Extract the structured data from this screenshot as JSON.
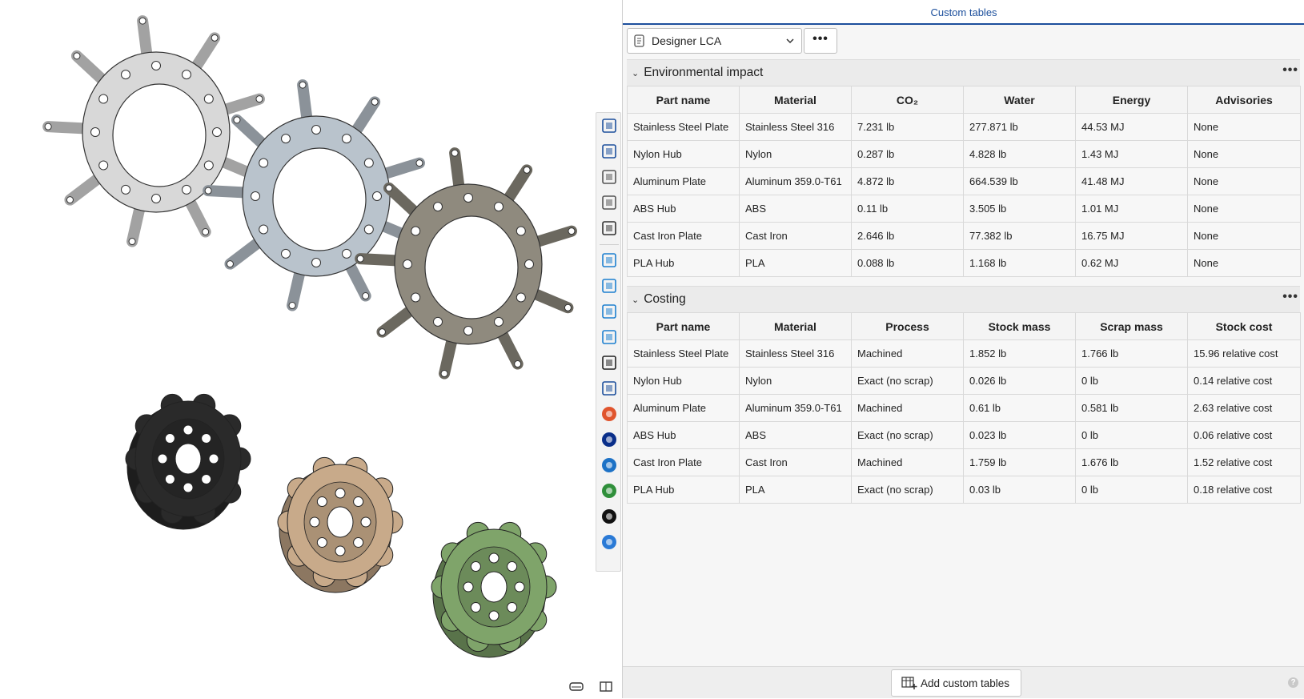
{
  "panel": {
    "title": "Custom tables",
    "selector_value": "Designer LCA",
    "more_label": "•••",
    "add_button_label": "Add custom tables",
    "help_label": "?"
  },
  "environmental": {
    "title": "Environmental impact",
    "columns": [
      "Part name",
      "Material",
      "CO₂",
      "Water",
      "Energy",
      "Advisories"
    ],
    "rows": [
      [
        "Stainless Steel Plate",
        "Stainless Steel 316",
        "7.231 lb",
        "277.871 lb",
        "44.53 MJ",
        "None"
      ],
      [
        "Nylon Hub",
        "Nylon",
        "0.287 lb",
        "4.828 lb",
        "1.43 MJ",
        "None"
      ],
      [
        "Aluminum Plate",
        "Aluminum 359.0-T61",
        "4.872 lb",
        "664.539 lb",
        "41.48 MJ",
        "None"
      ],
      [
        "ABS Hub",
        "ABS",
        "0.11 lb",
        "3.505 lb",
        "1.01 MJ",
        "None"
      ],
      [
        "Cast Iron Plate",
        "Cast Iron",
        "2.646 lb",
        "77.382 lb",
        "16.75 MJ",
        "None"
      ],
      [
        "PLA Hub",
        "PLA",
        "0.088 lb",
        "1.168 lb",
        "0.62 MJ",
        "None"
      ]
    ]
  },
  "costing": {
    "title": "Costing",
    "columns": [
      "Part name",
      "Material",
      "Process",
      "Stock mass",
      "Scrap mass",
      "Stock cost"
    ],
    "rows": [
      [
        "Stainless Steel Plate",
        "Stainless Steel 316",
        "Machined",
        "1.852 lb",
        "1.766 lb",
        "15.96 relative cost"
      ],
      [
        "Nylon Hub",
        "Nylon",
        "Exact (no scrap)",
        "0.026 lb",
        "0 lb",
        "0.14 relative cost"
      ],
      [
        "Aluminum Plate",
        "Aluminum 359.0-T61",
        "Machined",
        "0.61 lb",
        "0.581 lb",
        "2.63 relative cost"
      ],
      [
        "ABS Hub",
        "ABS",
        "Exact (no scrap)",
        "0.023 lb",
        "0 lb",
        "0.06 relative cost"
      ],
      [
        "Cast Iron Plate",
        "Cast Iron",
        "Machined",
        "1.759 lb",
        "1.676 lb",
        "1.52 relative cost"
      ],
      [
        "PLA Hub",
        "PLA",
        "Exact (no scrap)",
        "0.03 lb",
        "0 lb",
        "0.18 relative cost"
      ]
    ]
  },
  "viewport": {
    "plates": [
      {
        "name": "stainless-steel-plate",
        "color": "#d8d8d8"
      },
      {
        "name": "aluminum-plate",
        "color": "#b9c3cc"
      },
      {
        "name": "cast-iron-plate",
        "color": "#8f8a7e"
      }
    ],
    "hubs": [
      {
        "name": "abs-hub",
        "color": "#2a2a2a"
      },
      {
        "name": "nylon-hub",
        "color": "#c8aa8a"
      },
      {
        "name": "pla-hub",
        "color": "#7fa46a"
      }
    ]
  },
  "toolbar": {
    "icons": [
      "appearance-icon",
      "parts-icon",
      "assembly-icon",
      "render-icon",
      "variables-icon",
      "list-icon",
      "bom-icon",
      "documents-icon",
      "calendar-icon",
      "learning-icon",
      "inspect-icon",
      "color-wheel-icon",
      "analysis-icon",
      "board-icon",
      "globe-icon",
      "dark-app-icon",
      "blue-app-icon"
    ]
  },
  "colors": {
    "accent": "#1c4f9c",
    "panel_bg": "#f6f6f6"
  }
}
